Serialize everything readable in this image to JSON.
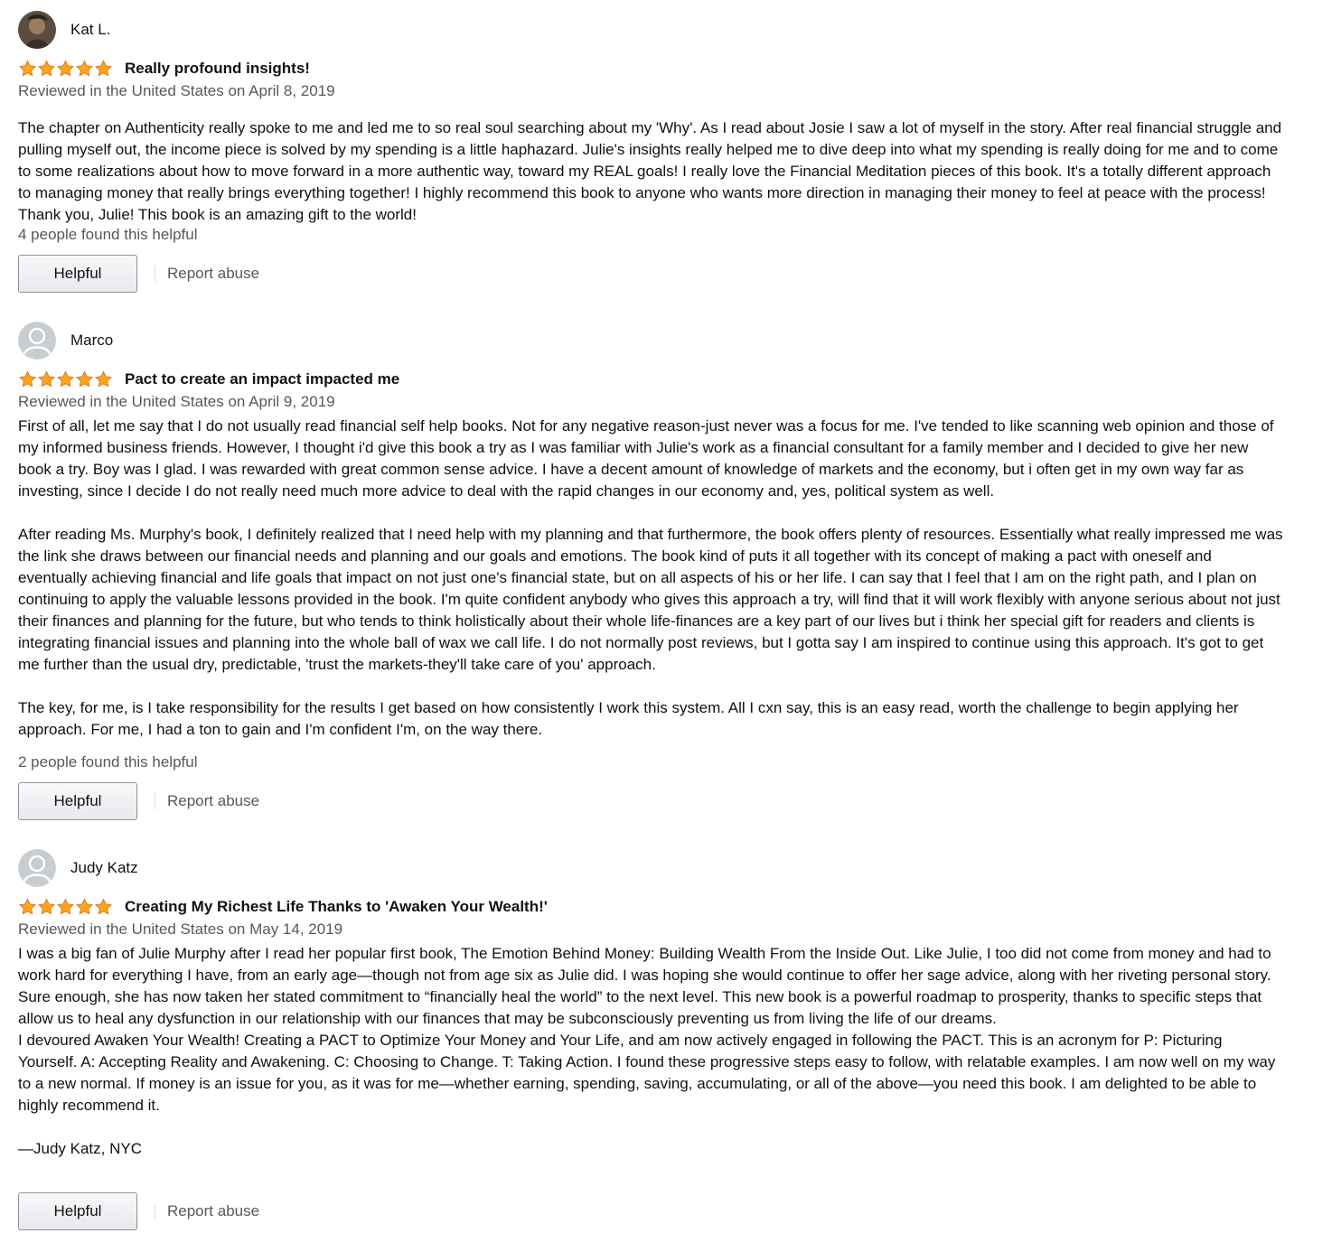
{
  "reviews": [
    {
      "author": "Kat L.",
      "avatar_icon": "user-photo-avatar",
      "rating": 5,
      "title": "Really profound insights!",
      "meta": "Reviewed in the United States on April 8, 2019",
      "paragraphs": [
        "The chapter on Authenticity really spoke to me and led me to so real soul searching about my 'Why'. As I read about Josie I saw a lot of myself in the story. After real financial struggle and pulling myself out, the income piece is solved by my spending is a little haphazard. Julie's insights really helped me to dive deep into what my spending is really doing for me and to come to some realizations about how to move forward in a more authentic way, toward my REAL goals! I really love the Financial Meditation pieces of this book. It's a totally different approach to managing money that really brings everything together! I highly recommend this book to anyone who wants more direction in managing their money to feel at peace with the process! Thank you, Julie! This book is an amazing gift to the world!"
      ],
      "helpful_count": "4 people found this helpful",
      "helpful_label": "Helpful",
      "report_label": "Report abuse"
    },
    {
      "author": "Marco",
      "avatar_icon": "default-user-icon",
      "rating": 5,
      "title": "Pact to create an impact impacted me",
      "meta": "Reviewed in the United States on April 9, 2019",
      "paragraphs": [
        "First of all, let me say that I do not usually read financial self help books. Not for any negative reason-just never was a focus for me. I've tended to like scanning web opinion and those of my informed business friends. However, I thought i'd give this book a try as I was familiar with Julie's work as a financial consultant for a family member and I decided to give her new book a try. Boy was I glad. I was rewarded with great common sense advice. I have a decent amount of knowledge of markets and the economy, but i often get in my own way far as investing, since I decide I do not really need much more advice to deal with the rapid changes in our economy and, yes, political system as well.",
        "After reading Ms. Murphy's book, I definitely realized that I need help with my planning and that furthermore, the book offers plenty of resources. Essentially what really impressed me was the link she draws between our financial needs and planning and our goals and emotions. The book kind of puts it all together with its concept of making a pact with oneself and eventually achieving financial and life goals that impact on not just one's financial state, but on all aspects of his or her life. I can say that I feel that I am on the right path, and I plan on continuing to apply the valuable lessons provided in the book. I'm quite confident anybody who gives this approach a try, will find that it will work flexibly with anyone serious about not just their finances and planning for the future, but who tends to think holistically about their whole life-finances are a key part of our lives but i think her special gift for readers and clients is integrating financial issues and planning into the whole ball of wax we call life. I do not normally post reviews, but I gotta say I am inspired to continue using this approach. It's got to get me further than the usual dry, predictable, 'trust the markets-they'll take care of you' approach.",
        "The key, for me, is I take responsibility for the results I get based on how consistently I work this system. All I cxn say, this is an easy read, worth the challenge to begin applying her approach. For me, I had a ton to gain and I'm confident I'm, on the way there."
      ],
      "helpful_count": "2 people found this helpful",
      "helpful_label": "Helpful",
      "report_label": "Report abuse"
    },
    {
      "author": "Judy Katz",
      "avatar_icon": "default-user-icon",
      "rating": 5,
      "title": "Creating My Richest Life Thanks to 'Awaken Your Wealth!'",
      "meta": "Reviewed in the United States on May 14, 2019",
      "paragraphs": [
        "I was a big fan of Julie Murphy after I read her popular first book, The Emotion Behind Money: Building Wealth From the Inside Out. Like Julie, I too did not come from money and had to work hard for everything I have, from an early age—though not from age six as Julie did. I was hoping she would continue to offer her sage advice, along with her riveting personal story. Sure enough, she has now taken her stated commitment to “financially heal the world” to the next level. This new book is a powerful roadmap to prosperity, thanks to specific steps that allow us to heal any dysfunction in our relationship with our finances that may be subconsciously preventing us from living the life of our dreams.",
        "I devoured Awaken Your Wealth! Creating a PACT to Optimize Your Money and Your Life, and am now actively engaged in following the PACT. This is an acronym for P: Picturing Yourself. A: Accepting Reality and Awakening. C: Choosing to Change. T: Taking Action. I found these progressive steps easy to follow, with relatable examples. I am now well on my way to a new normal. If money is an issue for you, as it was for me—whether earning, spending, saving, accumulating, or all of the above—you need this book. I am delighted to be able to highly recommend it.",
        "—Judy Katz, NYC"
      ],
      "helpful_label": "Helpful",
      "report_label": "Report abuse"
    }
  ],
  "colors": {
    "star_fill": "#FFA41C",
    "star_stroke": "#DE7921",
    "meta_text": "#565959",
    "default_avatar_bg": "#C8CDD0"
  }
}
